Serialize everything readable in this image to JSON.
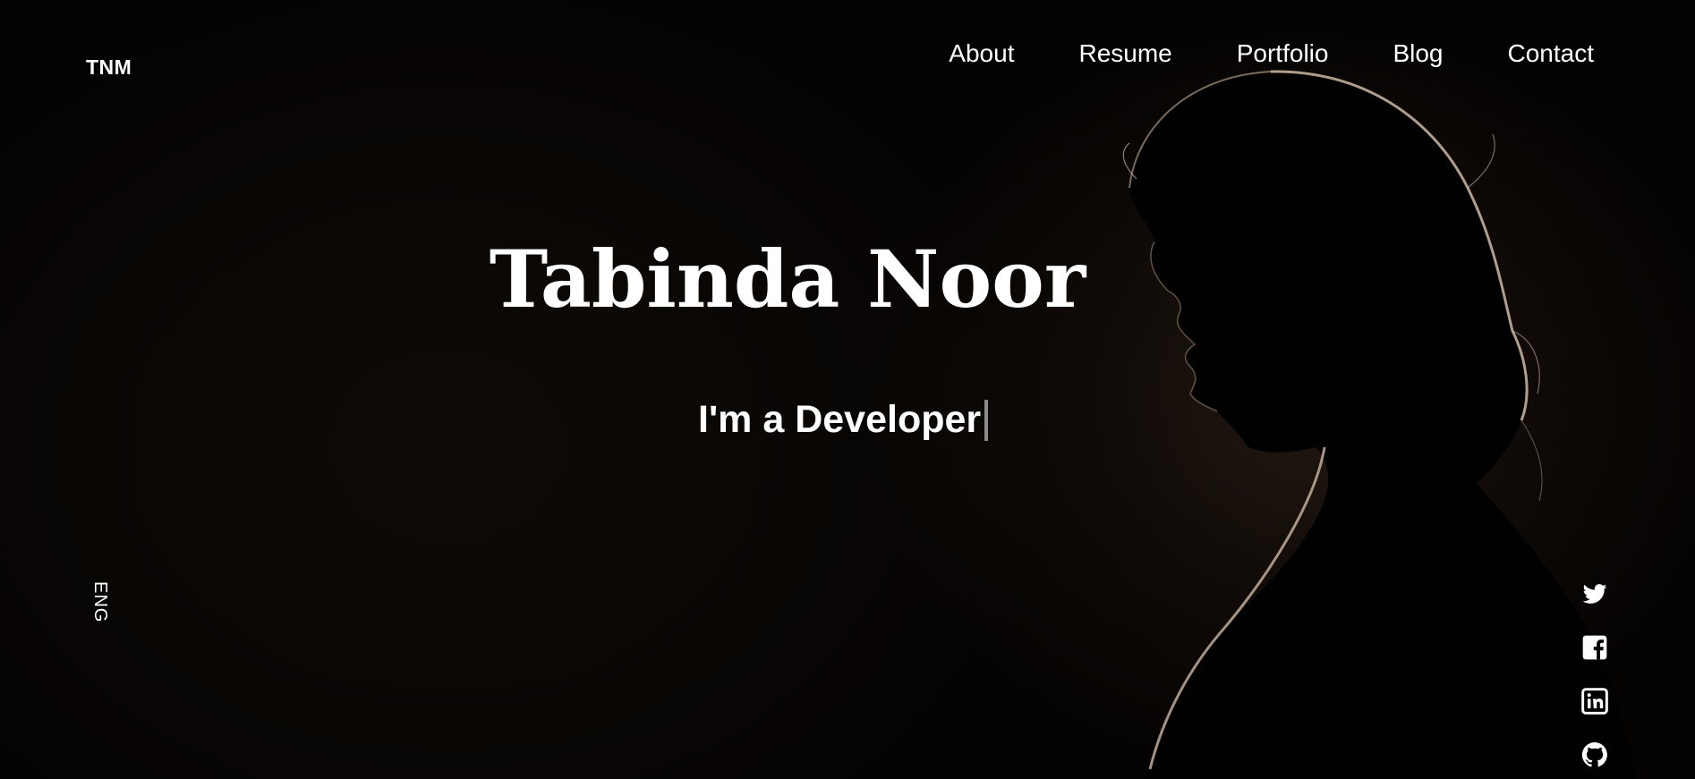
{
  "header": {
    "logo": "TNM",
    "nav": [
      {
        "label": "About"
      },
      {
        "label": "Resume"
      },
      {
        "label": "Portfolio"
      },
      {
        "label": "Blog"
      },
      {
        "label": "Contact"
      }
    ]
  },
  "hero": {
    "name": "Tabinda Noor",
    "subtitle": "I'm a Developer"
  },
  "sidebar": {
    "language": "ENG"
  },
  "social": [
    {
      "icon": "twitter-icon"
    },
    {
      "icon": "facebook-icon"
    },
    {
      "icon": "linkedin-icon"
    },
    {
      "icon": "github-icon"
    }
  ],
  "colors": {
    "background": "#050302",
    "text": "#ffffff",
    "cursor": "#8a8a8a",
    "rim_light": "#e8d2b8"
  }
}
